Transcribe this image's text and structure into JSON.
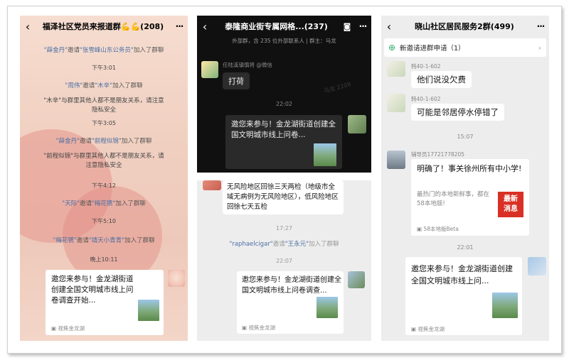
{
  "panel1": {
    "title": "福泽社区党员来报道群💪💪(208)",
    "back": "‹",
    "more": "···",
    "sys1": {
      "a": "\"薛金丹\"",
      "mid": "邀请",
      "b": "\"张雪峰山东公务员\"",
      "end": "加入了群聊"
    },
    "t1": "下午3:01",
    "sys2": {
      "a": "\"周伟\"",
      "mid": "邀请",
      "b": "\"木辛\"",
      "end": "加入了群聊"
    },
    "notice1": "\"木辛\"与群里其他人都不是朋友关系，请注意隐私安全",
    "t2": "下午3:05",
    "sys3": {
      "a": "\"薛金丹\"",
      "mid": "邀请",
      "b": "\"前程似锦\"",
      "end": "加入了群聊"
    },
    "notice2": "\"前程似锦\"与群里其他人都不是朋友关系，请注意隐私安全",
    "t3": "下午4:12",
    "sys4": {
      "a": "\"天际\"",
      "mid": "邀请",
      "b": "\"梅花镌\"",
      "end": "加入了群聊"
    },
    "t4": "下午5:10",
    "sys5": {
      "a": "\"梅花镌\"",
      "mid": "邀请",
      "b": "\"靖天小青青\"",
      "end": "加入了群聊"
    },
    "t5": "晚上10:11",
    "card": {
      "title": "邀您来参与！金龙湖街道创建全国文明城市线上问卷调查开始...",
      "foot": "视焦金龙湖"
    }
  },
  "panel2": {
    "title": "泰隆商业街专属网格...(237)",
    "back": "‹",
    "more": "···",
    "sub": "外部群，含 235 位外部联系人 | 群主：马龙",
    "sender1": "任陆溪镇慎将 @微信",
    "msg1": "打荷",
    "watermark": "马龙 2209",
    "t1": "22:02",
    "card1": {
      "title": "邀您来参与！金龙湖街道创建全国文明城市线上问卷..."
    },
    "msg2": "无风险地区回徐三天两检（地级市全域无病例为无风险地区），低风险地区回徐七天五检",
    "t2": "17:27",
    "sys": {
      "a": "\"raphaelcigar\"",
      "mid": "邀请",
      "b": "\"王永元\"",
      "end": "加入了群聊"
    },
    "t3": "22:07",
    "card2": {
      "title": "邀您来参与！金龙湖街道创建全国文明城市线上问卷调查...",
      "foot": "视焦金龙湖"
    }
  },
  "panel3": {
    "title": "晓山社区居民服务2群(499)",
    "back": "‹",
    "more": "···",
    "request": "新邀请进群申请（1）",
    "s1": "韩40-1-602",
    "m1": "他们说没欠费",
    "s2": "韩40-1-602",
    "m2": "可能是邻居停水停错了",
    "t1": "15:07",
    "s3": "辅导员17721778205",
    "card1": {
      "title": "明确了！事关徐州所有中小学!",
      "desc": "最热门的本地新鲜事，都在58本地版!",
      "badge": "最新\n消息",
      "foot": "58本地版Beta"
    },
    "t2": "22:01",
    "card2": {
      "title": "邀您来参与！金龙湖街道创建全国文明城市线上问...",
      "foot": "视焦金龙湖"
    }
  }
}
